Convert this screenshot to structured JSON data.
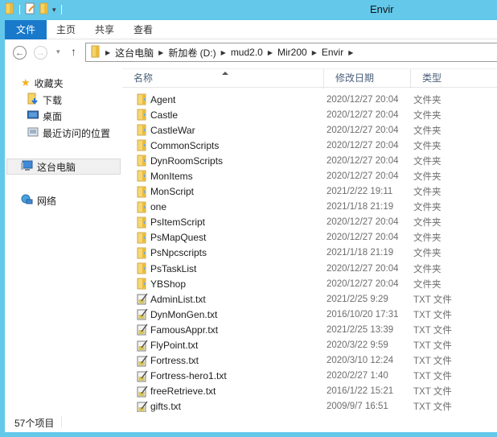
{
  "window": {
    "title": "Envir",
    "accent_color": "#63c8ea",
    "file_tab_color": "#1979ca"
  },
  "quick_access_toolbar": {
    "icons": [
      "folder-icon",
      "properties-icon",
      "new-folder-icon",
      "customize-dropdown-icon"
    ]
  },
  "ribbon": {
    "tabs": [
      {
        "label": "文件",
        "active": true
      },
      {
        "label": "主页"
      },
      {
        "label": "共享"
      },
      {
        "label": "查看"
      }
    ]
  },
  "navigation": {
    "back_icon": "←",
    "forward_icon": "→",
    "recent_icon": "▾",
    "up_icon": "↑",
    "breadcrumb": [
      "这台电脑",
      "新加卷 (D:)",
      "mud2.0",
      "Mir200",
      "Envir"
    ]
  },
  "sidebar": {
    "favorites": {
      "label": "收藏夹"
    },
    "favorite_items": [
      {
        "label": "下载",
        "icon": "downloads-icon"
      },
      {
        "label": "桌面",
        "icon": "desktop-icon"
      },
      {
        "label": "最近访问的位置",
        "icon": "recent-places-icon"
      }
    ],
    "this_pc": {
      "label": "这台电脑",
      "selected": true
    },
    "network": {
      "label": "网络"
    }
  },
  "columns": {
    "name": "名称",
    "date": "修改日期",
    "type": "类型",
    "sort": "ascending"
  },
  "files": [
    {
      "name": "Agent",
      "date": "2020/12/27 20:04",
      "type": "文件夹",
      "kind": "folder"
    },
    {
      "name": "Castle",
      "date": "2020/12/27 20:04",
      "type": "文件夹",
      "kind": "folder"
    },
    {
      "name": "CastleWar",
      "date": "2020/12/27 20:04",
      "type": "文件夹",
      "kind": "folder"
    },
    {
      "name": "CommonScripts",
      "date": "2020/12/27 20:04",
      "type": "文件夹",
      "kind": "folder"
    },
    {
      "name": "DynRoomScripts",
      "date": "2020/12/27 20:04",
      "type": "文件夹",
      "kind": "folder"
    },
    {
      "name": "MonItems",
      "date": "2020/12/27 20:04",
      "type": "文件夹",
      "kind": "folder"
    },
    {
      "name": "MonScript",
      "date": "2021/2/22 19:11",
      "type": "文件夹",
      "kind": "folder"
    },
    {
      "name": "one",
      "date": "2021/1/18 21:19",
      "type": "文件夹",
      "kind": "folder"
    },
    {
      "name": "PsItemScript",
      "date": "2020/12/27 20:04",
      "type": "文件夹",
      "kind": "folder"
    },
    {
      "name": "PsMapQuest",
      "date": "2020/12/27 20:04",
      "type": "文件夹",
      "kind": "folder"
    },
    {
      "name": "PsNpcscripts",
      "date": "2021/1/18 21:19",
      "type": "文件夹",
      "kind": "folder"
    },
    {
      "name": "PsTaskList",
      "date": "2020/12/27 20:04",
      "type": "文件夹",
      "kind": "folder"
    },
    {
      "name": "YBShop",
      "date": "2020/12/27 20:04",
      "type": "文件夹",
      "kind": "folder"
    },
    {
      "name": "AdminList.txt",
      "date": "2021/2/25 9:29",
      "type": "TXT 文件",
      "kind": "txt"
    },
    {
      "name": "DynMonGen.txt",
      "date": "2016/10/20 17:31",
      "type": "TXT 文件",
      "kind": "txt"
    },
    {
      "name": "FamousAppr.txt",
      "date": "2021/2/25 13:39",
      "type": "TXT 文件",
      "kind": "txt"
    },
    {
      "name": "FlyPoint.txt",
      "date": "2020/3/22 9:59",
      "type": "TXT 文件",
      "kind": "txt"
    },
    {
      "name": "Fortress.txt",
      "date": "2020/3/10 12:24",
      "type": "TXT 文件",
      "kind": "txt"
    },
    {
      "name": "Fortress-hero1.txt",
      "date": "2020/2/27 1:40",
      "type": "TXT 文件",
      "kind": "txt"
    },
    {
      "name": "freeRetrieve.txt",
      "date": "2016/1/22 15:21",
      "type": "TXT 文件",
      "kind": "txt"
    },
    {
      "name": "gifts.txt",
      "date": "2009/9/7 16:51",
      "type": "TXT 文件",
      "kind": "txt"
    }
  ],
  "status": {
    "item_count": "57个项目"
  }
}
